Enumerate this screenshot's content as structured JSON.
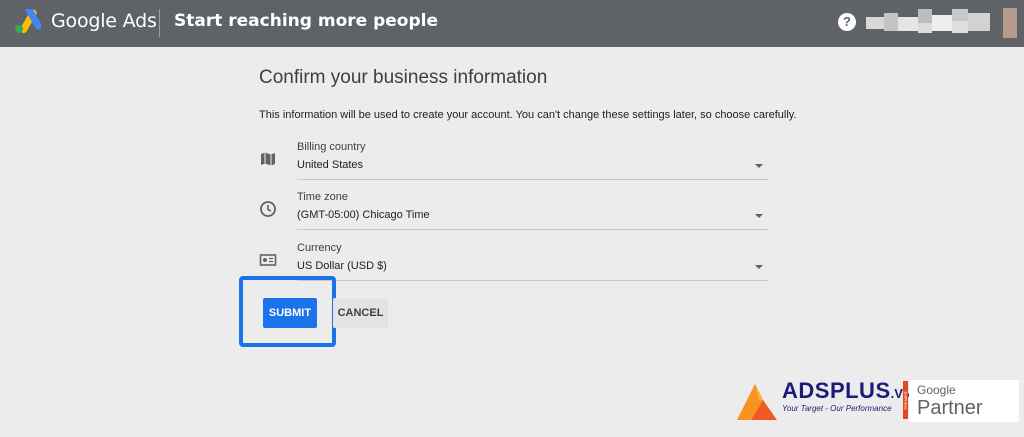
{
  "header": {
    "app_name": "Google Ads",
    "page_title": "Start reaching more people",
    "help_symbol": "?",
    "icons": [
      "google-ads-logo-icon",
      "help-icon",
      "avatar"
    ]
  },
  "form": {
    "title": "Confirm your business information",
    "description": "This information will be used to create your account. You can't change these settings later, so choose carefully.",
    "fields": [
      {
        "label": "Billing country",
        "value": "United States",
        "icon": "map-icon"
      },
      {
        "label": "Time zone",
        "value": "(GMT-05:00) Chicago Time",
        "icon": "clock-icon"
      },
      {
        "label": "Currency",
        "value": "US Dollar (USD $)",
        "icon": "currency-icon"
      }
    ],
    "submit_label": "SUBMIT",
    "cancel_label": "CANCEL",
    "highlight_color": "#1a73e8"
  },
  "watermark": {
    "brand": "ADSPLUS",
    "tld": ".VN",
    "tagline": "Your Target - Our Performance",
    "premier": "PREMIER",
    "google": "Google",
    "partner": "Partner"
  },
  "colors": {
    "topbar": "#5f6368",
    "background": "#ececec",
    "accent": "#1a73e8"
  }
}
